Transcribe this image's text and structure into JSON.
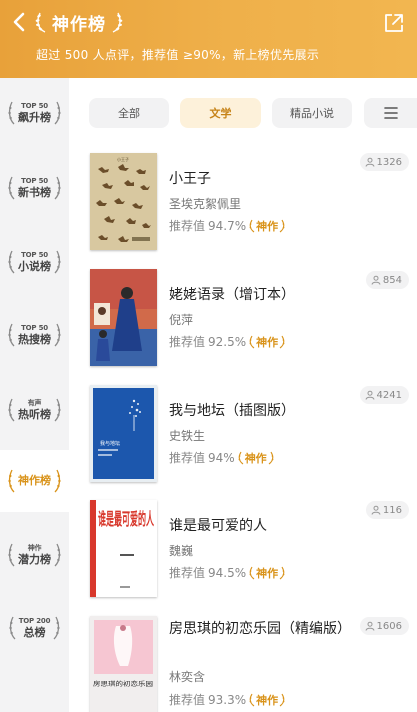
{
  "header": {
    "title": "神作榜",
    "subtitle": "超过 500 人点评，推荐值 ≥90%，新上榜优先展示"
  },
  "sidebar": {
    "items": [
      {
        "top": "TOP 50",
        "label": "飙升榜"
      },
      {
        "top": "TOP 50",
        "label": "新书榜"
      },
      {
        "top": "TOP 50",
        "label": "小说榜"
      },
      {
        "top": "TOP 50",
        "label": "热搜榜"
      },
      {
        "top": "有声",
        "label": "热听榜"
      },
      {
        "top": "",
        "label": "神作榜",
        "active": true
      },
      {
        "top": "神作",
        "label": "潜力榜"
      },
      {
        "top": "TOP 200",
        "label": "总榜"
      }
    ]
  },
  "tabs": [
    {
      "label": "全部"
    },
    {
      "label": "文学",
      "active": true
    },
    {
      "label": "精品小说"
    }
  ],
  "rec_label": "推荐值",
  "badge_label": "神作",
  "books": [
    {
      "title": "小王子",
      "author": "圣埃克絮佩里",
      "rec": "94.7%",
      "readers": "1326",
      "cover_caption": "小王子"
    },
    {
      "title": "姥姥语录（增订本）",
      "author": "倪萍",
      "rec": "92.5%",
      "readers": "854",
      "cover_caption": ""
    },
    {
      "title": "我与地坛（插图版）",
      "author": "史铁生",
      "rec": "94%",
      "readers": "4241",
      "cover_caption": "我与地坛"
    },
    {
      "title": "谁是最可爱的人",
      "author": "魏巍",
      "rec": "94.5%",
      "readers": "116",
      "cover_caption": "谁是最可爱的人"
    },
    {
      "title": "房思琪的初恋乐园（精编版）",
      "author": "林奕含",
      "rec": "93.3%",
      "readers": "1606",
      "cover_caption": "房思琪的初恋乐园"
    }
  ],
  "colors": {
    "header_start": "#e8a13a",
    "header_end": "#f2b650",
    "accent": "#d9931a",
    "sidebar_bg": "#f3f3f4"
  },
  "icons": {
    "back": "chevron-left-icon",
    "share": "share-icon",
    "menu": "menu-icon",
    "readers": "user-icon"
  }
}
